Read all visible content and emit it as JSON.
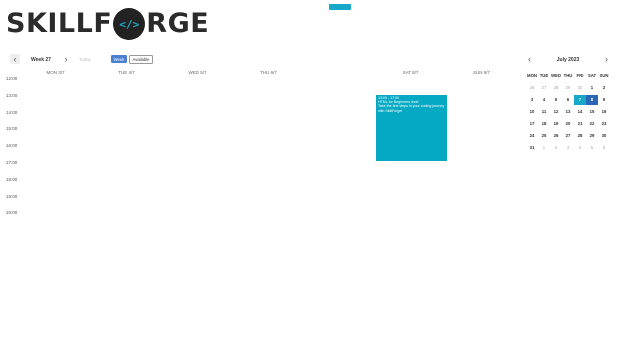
{
  "logo": {
    "left": "SKILLF",
    "code": "</>",
    "right": "RGE"
  },
  "toolbar": {
    "prev_icon": "‹",
    "week_label": "Week 27",
    "next_icon": "›",
    "today_label": "Today",
    "week_view_label": "Week",
    "available_label": "Available"
  },
  "week": {
    "days": [
      "MON 3/7",
      "TUE 4/7",
      "WED 5/7",
      "THU 6/7",
      "FRI 7/7",
      "SAT 8/7",
      "SUN 9/7"
    ],
    "today_index": 4,
    "times": [
      "12:00",
      "13:00",
      "14:00",
      "15:00",
      "16:00",
      "17:00",
      "18:00",
      "19:00",
      "20:00"
    ]
  },
  "event": {
    "time": "13:00 - 17:00",
    "title": "HTML for Beginners level",
    "desc": "Take the first steps in your coding journey with SkillForge!"
  },
  "mini": {
    "title": "July 2023",
    "prev_icon": "‹",
    "next_icon": "›",
    "dow": [
      "MON",
      "TUE",
      "WED",
      "THU",
      "FRI",
      "SAT",
      "SUN"
    ],
    "weeks": [
      [
        "26",
        "27",
        "28",
        "29",
        "30",
        "1",
        "2"
      ],
      [
        "3",
        "4",
        "5",
        "6",
        "7",
        "8",
        "9"
      ],
      [
        "10",
        "11",
        "12",
        "13",
        "14",
        "15",
        "16"
      ],
      [
        "17",
        "18",
        "19",
        "20",
        "21",
        "22",
        "23"
      ],
      [
        "24",
        "25",
        "26",
        "27",
        "28",
        "29",
        "30"
      ],
      [
        "31",
        "1",
        "2",
        "3",
        "4",
        "5",
        "6"
      ]
    ],
    "today": "7",
    "selected": "8"
  },
  "colors": {
    "accent": "#17a8c9",
    "event": "#06a9c4",
    "selected": "#2b67b8",
    "primary_button": "#4a7fd1"
  }
}
